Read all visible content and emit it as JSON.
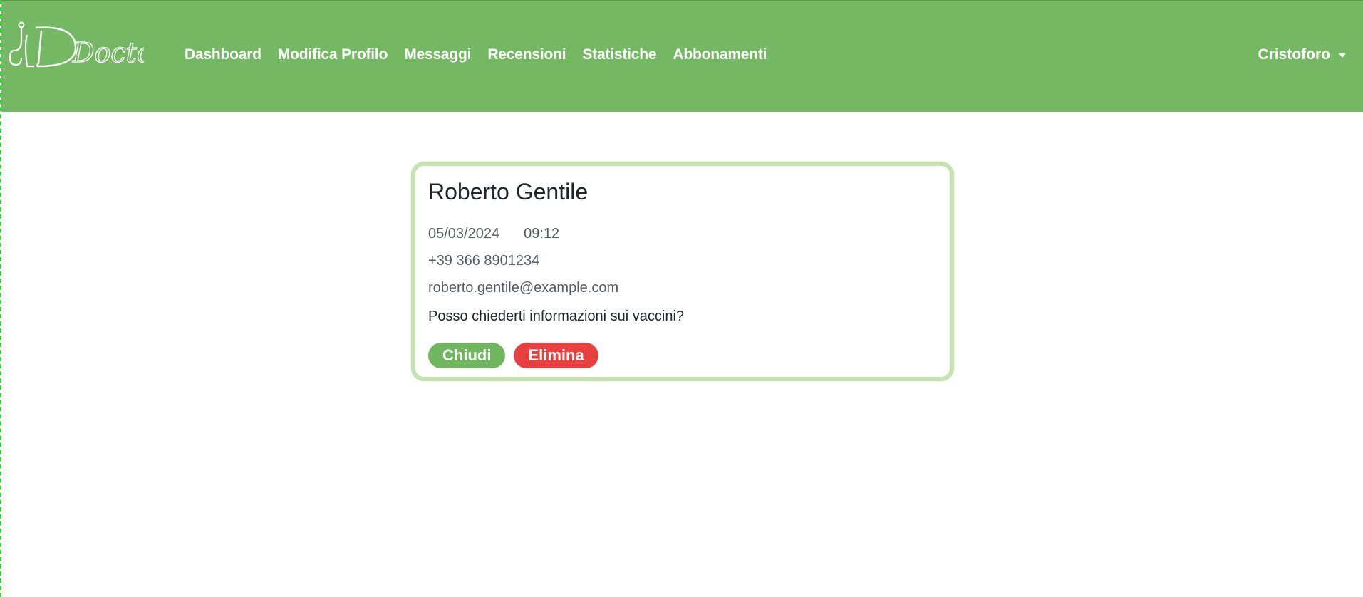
{
  "navbar": {
    "logo_text": "Doctors",
    "links": [
      "Dashboard",
      "Modifica Profilo",
      "Messaggi",
      "Recensioni",
      "Statistiche",
      "Abbonamenti"
    ],
    "user": "Cristoforo",
    "accent": "#74b863"
  },
  "message_card": {
    "name": "Roberto Gentile",
    "date": "05/03/2024",
    "time": "09:12",
    "phone": "+39 366 8901234",
    "email": "roberto.gentile@example.com",
    "text": "Posso chiederti informazioni sui vaccini?",
    "close_label": "Chiudi",
    "delete_label": "Elimina",
    "close_color": "#6fb65e",
    "delete_color": "#e8403f"
  }
}
